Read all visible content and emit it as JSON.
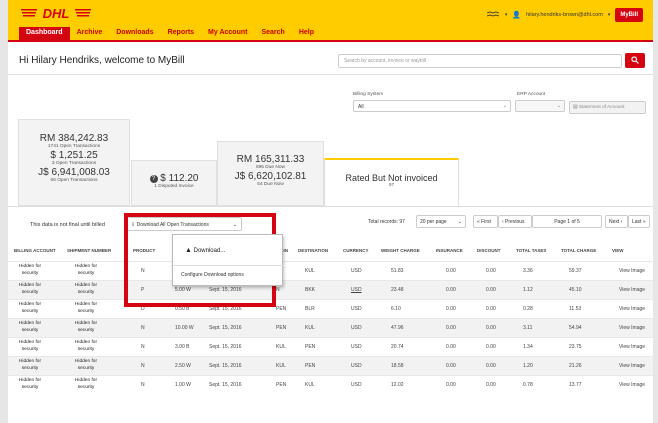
{
  "header": {
    "logo": "DHL",
    "user_email": "hilary.hendriks-brown@dhl.com",
    "mybill_button": "MyBill",
    "nav": [
      "Dashboard",
      "Archive",
      "Downloads",
      "Reports",
      "My Account",
      "Search",
      "Help"
    ]
  },
  "welcome": "Hi Hilary Hendriks, welcome to MyBill",
  "search": {
    "placeholder": "Search by account, invoice or waybill"
  },
  "filters": {
    "billing_label": "Billing System",
    "billing_value": "All",
    "erp_label": "ERP Account",
    "statement_button": "Statement of Account"
  },
  "cards": {
    "open": {
      "rm_amount": "RM 384,242.83",
      "rm_count": "1741 Open Transactions",
      "usd_amount": "$ 1,251.25",
      "usd_count": "3 Open Transactions",
      "jpy_amount": "J$ 6,941,008.03",
      "jpy_count": "66 Open Transactions"
    },
    "disputed": {
      "amount": "$ 112.20",
      "label": "1 Disputed Invoice"
    },
    "due": {
      "rm_amount": "RM 165,311.33",
      "rm_count": "695 Due Now",
      "jpy_amount": "J$ 6,620,102.81",
      "jpy_count": "54 Due Now"
    },
    "rated": {
      "title": "Rated But Not invoiced",
      "count": "97"
    }
  },
  "toolbar": {
    "final_note": "This data is not final until billed",
    "download_button": "Download All Open Transactions",
    "total_records": "Total records: 97",
    "per_page": "20 per page",
    "first": "« First",
    "previous": "‹ Previous",
    "page_label": "Page",
    "page_value": "1",
    "page_of": "of 5",
    "next": "Next ›",
    "last": "Last »"
  },
  "dropdown": {
    "download": "Download...",
    "configure": "Configure Download options"
  },
  "table": {
    "headers": [
      "BILLING ACCOUNT",
      "SHIPMENT NUMBER",
      "PRODUCT",
      "ORIGIN",
      "DESTINATION",
      "CURRENCY",
      "WEIGHT CHARGE",
      "INSURANCE",
      "DISCOUNT",
      "TOTAL TAXES",
      "TOTAL CHARGE",
      "VIEW"
    ],
    "hidden_text": "Hidden for security",
    "rows": [
      {
        "product": "N",
        "weight": "",
        "date": "",
        "origin": "",
        "dest": "KUL",
        "currency": "USD",
        "charge": "51.83",
        "insurance": "0.00",
        "discount": "0.00",
        "taxes": "3.36",
        "total": "59.37",
        "view": "View Image"
      },
      {
        "product": "P",
        "weight": "5.00 W",
        "date": "Sept. 15, 2016",
        "origin": "N",
        "dest": "BKK",
        "currency": "USD",
        "charge": "23.48",
        "insurance": "0.00",
        "discount": "0.00",
        "taxes": "1.12",
        "total": "45.10",
        "view": "View Image"
      },
      {
        "product": "D",
        "weight": "0.50 B",
        "date": "Sept. 15, 2016",
        "origin": "PEN",
        "dest": "BLR",
        "currency": "USD",
        "charge": "6.10",
        "insurance": "0.00",
        "discount": "0.00",
        "taxes": "0.28",
        "total": "11.53",
        "view": "View Image"
      },
      {
        "product": "N",
        "weight": "10.00 W",
        "date": "Sept. 15, 2016",
        "origin": "PEN",
        "dest": "KUL",
        "currency": "USD",
        "charge": "47.96",
        "insurance": "0.00",
        "discount": "0.00",
        "taxes": "3.11",
        "total": "54.94",
        "view": "View Image"
      },
      {
        "product": "N",
        "weight": "3.00 B",
        "date": "Sept. 15, 2016",
        "origin": "KUL",
        "dest": "PEN",
        "currency": "USD",
        "charge": "20.74",
        "insurance": "0.00",
        "discount": "0.00",
        "taxes": "1.34",
        "total": "23.75",
        "view": "View Image"
      },
      {
        "product": "N",
        "weight": "2.50 W",
        "date": "Sept. 15, 2016",
        "origin": "KUL",
        "dest": "PEN",
        "currency": "USD",
        "charge": "18.58",
        "insurance": "0.00",
        "discount": "0.00",
        "taxes": "1.20",
        "total": "21.26",
        "view": "View Image"
      },
      {
        "product": "N",
        "weight": "1.00 W",
        "date": "Sept. 15, 2016",
        "origin": "PEN",
        "dest": "KUL",
        "currency": "USD",
        "charge": "12.02",
        "insurance": "0.00",
        "discount": "0.00",
        "taxes": "0.78",
        "total": "13.77",
        "view": "View Image"
      }
    ]
  },
  "colors": {
    "brand_yellow": "#ffcc00",
    "brand_red": "#d40511"
  }
}
